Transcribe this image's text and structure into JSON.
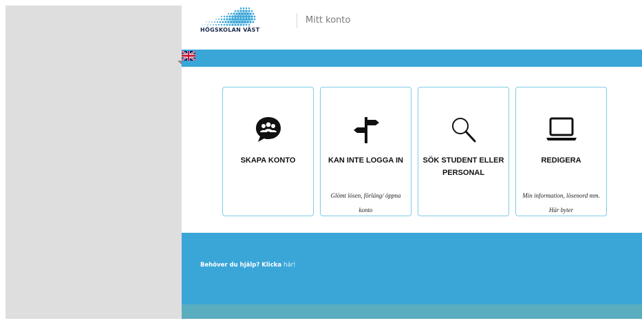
{
  "header": {
    "logo_text": "HÖGSKOLAN VÄST",
    "title": "Mitt konto"
  },
  "language": {
    "flag": "uk-flag-icon"
  },
  "cards": [
    {
      "title": "SKAPA KONTO",
      "desc": "",
      "icon": "people-chat-icon"
    },
    {
      "title": "KAN INTE LOGGA IN",
      "desc": "Glömt lösen, förläng/ öppna konto",
      "icon": "signpost-icon"
    },
    {
      "title": "SÖK STUDENT ELLER PERSONAL",
      "desc": "",
      "icon": "magnifier-icon"
    },
    {
      "title": "REDIGERA",
      "desc": "Min information, lösenord mm. Här byter",
      "icon": "laptop-icon"
    }
  ],
  "footer": {
    "help_text": "Behöver du hjälp? Klicka ",
    "help_link": "här!"
  },
  "colors": {
    "accent": "#3aa6d8",
    "card_border": "#7ecbe5",
    "footer_bottom": "#5aacbf",
    "left_panel": "#dedede"
  }
}
